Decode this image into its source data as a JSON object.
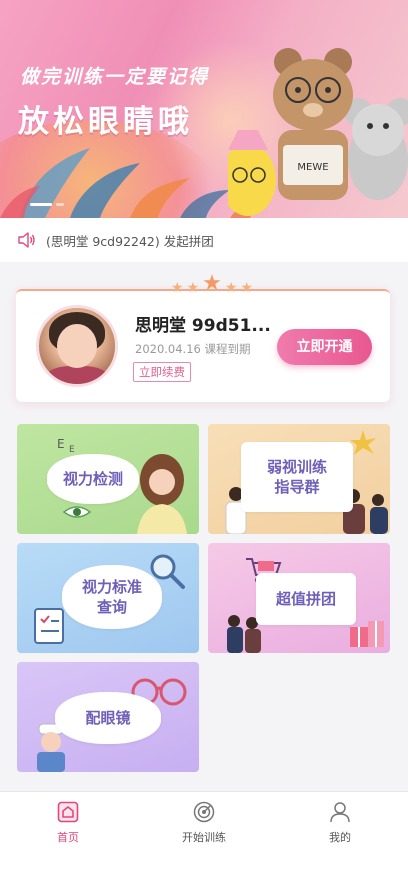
{
  "banner": {
    "subtitle": "做完训练一定要记得",
    "title": "放松眼睛哦",
    "slides": 2,
    "active_slide": 1
  },
  "notice": {
    "icon": "speaker-icon",
    "text": "(思明堂 9cd92242) 发起拼团"
  },
  "member": {
    "name": "思明堂 99d51...",
    "expiry": "2020.04.16 课程到期",
    "renew_label": "立即续费",
    "open_label": "立即开通"
  },
  "tiles": [
    {
      "label_lines": [
        "视力检测"
      ],
      "color": "#b4df97"
    },
    {
      "label_lines": [
        "弱视训练",
        "指导群"
      ],
      "color": "#f5d6ab"
    },
    {
      "label_lines": [
        "视力标准",
        "查询"
      ],
      "color": "#acd2f3"
    },
    {
      "label_lines": [
        "超值拼团"
      ],
      "color": "#efbbe3"
    },
    {
      "label_lines": [
        "配眼镜"
      ],
      "color": "#d0baf4"
    }
  ],
  "tabbar": {
    "items": [
      {
        "label": "首页",
        "icon": "home-icon",
        "active": true
      },
      {
        "label": "开始训练",
        "icon": "target-icon",
        "active": false
      },
      {
        "label": "我的",
        "icon": "user-icon",
        "active": false
      }
    ],
    "active_color": "#e1477e"
  }
}
